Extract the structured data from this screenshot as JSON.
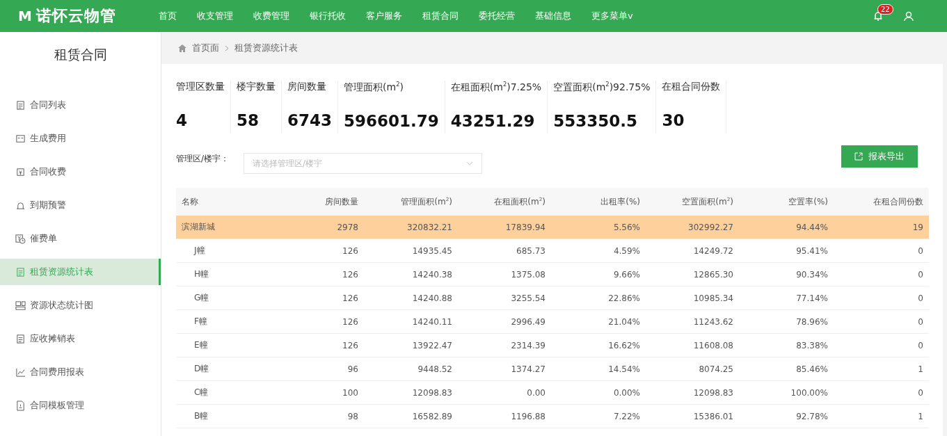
{
  "app": {
    "logo_letter": "M",
    "name": "诺怀云物管"
  },
  "nav": [
    {
      "label": "首页"
    },
    {
      "label": "收支管理"
    },
    {
      "label": "收费管理"
    },
    {
      "label": "银行托收"
    },
    {
      "label": "客户服务"
    },
    {
      "label": "租赁合同"
    },
    {
      "label": "委托经营"
    },
    {
      "label": "基础信息"
    },
    {
      "label": "更多菜单v"
    }
  ],
  "notifications": {
    "count": "22"
  },
  "sidebar": {
    "title": "租赁合同",
    "items": [
      {
        "label": "合同列表",
        "selected": false
      },
      {
        "label": "生成费用",
        "selected": false
      },
      {
        "label": "合同收费",
        "selected": false
      },
      {
        "label": "到期预警",
        "selected": false
      },
      {
        "label": "催费单",
        "selected": false
      },
      {
        "label": "租赁资源统计表",
        "selected": true
      },
      {
        "label": "资源状态统计图",
        "selected": false
      },
      {
        "label": "应收摊销表",
        "selected": false
      },
      {
        "label": "合同费用报表",
        "selected": false
      },
      {
        "label": "合同模板管理",
        "selected": false
      }
    ]
  },
  "breadcrumb": [
    "首页面",
    "租赁资源统计表"
  ],
  "stats": [
    {
      "label": "管理区数量",
      "value": "4"
    },
    {
      "label": "楼宇数量",
      "value": "58"
    },
    {
      "label": "房间数量",
      "value": "6743"
    },
    {
      "label": "管理面积(m$^{2}$)",
      "value": "596601.79"
    },
    {
      "label": "在租面积(m$^{2}$)7.25%",
      "value": "43251.29"
    },
    {
      "label": "空置面积(m$^{2}$)92.75%",
      "value": "553350.5"
    },
    {
      "label": "在租合同份数",
      "value": "30"
    }
  ],
  "filter": {
    "label": "管理区/楼宇：",
    "placeholder": "请选择管理区/楼宇"
  },
  "export_button": "报表导出",
  "table": {
    "columns": [
      "名称",
      "房间数量",
      "管理面积(m$^{2}$)",
      "在租面积(m$^{2}$)",
      "出租率(%)",
      "空置面积(m$^{2}$)",
      "空置率(%)",
      "在租合同份数"
    ],
    "rows": [
      {
        "cells": [
          "滨湖新城",
          "2978",
          "320832.21",
          "17839.94",
          "5.56%",
          "302992.27",
          "94.44%",
          "19"
        ],
        "children": [
          {
            "cells": [
              "J幢",
              "126",
              "14935.45",
              "685.73",
              "4.59%",
              "14249.72",
              "95.41%",
              "0"
            ]
          },
          {
            "cells": [
              "H幢",
              "126",
              "14240.38",
              "1375.08",
              "9.66%",
              "12865.30",
              "90.34%",
              "0"
            ]
          },
          {
            "cells": [
              "G幢",
              "126",
              "14240.88",
              "3255.54",
              "22.86%",
              "10985.34",
              "77.14%",
              "0"
            ]
          },
          {
            "cells": [
              "F幢",
              "126",
              "14240.11",
              "2996.49",
              "21.04%",
              "11243.62",
              "78.96%",
              "0"
            ]
          },
          {
            "cells": [
              "E幢",
              "126",
              "13922.47",
              "2314.39",
              "16.62%",
              "11608.08",
              "83.38%",
              "0"
            ]
          },
          {
            "cells": [
              "D幢",
              "96",
              "9448.52",
              "1374.27",
              "14.54%",
              "8074.25",
              "85.46%",
              "1"
            ]
          },
          {
            "cells": [
              "C幢",
              "100",
              "12098.83",
              "0.00",
              "0.00%",
              "12098.83",
              "100.00%",
              "0"
            ]
          },
          {
            "cells": [
              "B幢",
              "98",
              "16582.89",
              "1196.88",
              "7.22%",
              "15386.01",
              "92.78%",
              "1"
            ]
          }
        ]
      }
    ]
  }
}
